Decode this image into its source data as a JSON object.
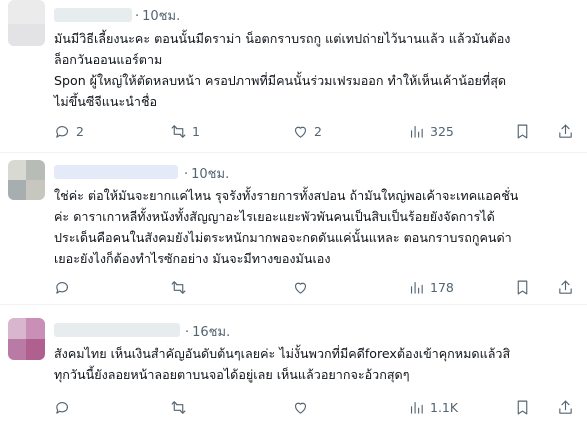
{
  "posts": [
    {
      "time": "10ชม.",
      "lines": [
        "มันมีวิธีเลี้ยงนะคะ ตอนนั้นมีดราม่า น็อตกราบรถกู แต่เทปถ่ายไว้นานแล้ว แล้วมันต้อง",
        "ล็อกวันออนแอร์ตาม",
        "Spon ผู้ใหญ่ให้ตัดหลบหน้า ครอปภาพที่มีคนนั้นร่วมเฟรมออก ทำให้เห็นเค้าน้อยที่สุด",
        "ไม่ขึ้นซีจีแนะนำชื่อ"
      ],
      "replies": "2",
      "reposts": "1",
      "likes": "2",
      "views": "325"
    },
    {
      "time": "10ชม.",
      "lines": [
        "ใช่ค่ะ ต่อให้มันจะยากแค่ไหน รุจรังทั้งรายการทั้งสปอน ถ้ามันใหญ่พอเค้าจะเทคแอคชั่น",
        "ค่ะ ดาราเกาหลีทั้งหนังทั้งสัญญาอะไรเยอะแยะพัวพันคนเป็นสิบเป็นร้อยยังจัดการได้",
        "ประเด็นคือคนในสังคมยังไม่ตระหนักมากพอจะกดดันแค่นั้นแหละ ตอนกราบรถกูคนด่า",
        "เยอะยังไงก็ต้องทำไรซักอย่าง มันจะมีทางของมันเอง"
      ],
      "replies": "",
      "reposts": "",
      "likes": "",
      "views": "178"
    },
    {
      "time": "16ชม.",
      "lines": [
        "สังคมไทย เห็นเงินสำคัญอันดับต้นๆเลยค่ะ ไม่งั้นพวกที่มีคดีforexต้องเข้าคุกหมดแล้วสิ",
        "ทุกวันนี้ยังลอยหน้าลอยตาบนจอได้อยู่เลย เห็นแล้วอยากจะอ้วกสุดๆ"
      ],
      "replies": "",
      "reposts": "",
      "likes": "",
      "views": "1.1K"
    }
  ],
  "icons": {
    "reply": "reply-icon",
    "repost": "repost-icon",
    "like": "like-icon",
    "views": "views-icon",
    "bookmark": "bookmark-icon",
    "share": "share-icon"
  },
  "colors": {
    "text": "#0f1419",
    "muted": "#536471",
    "divider": "#eff3f4"
  }
}
